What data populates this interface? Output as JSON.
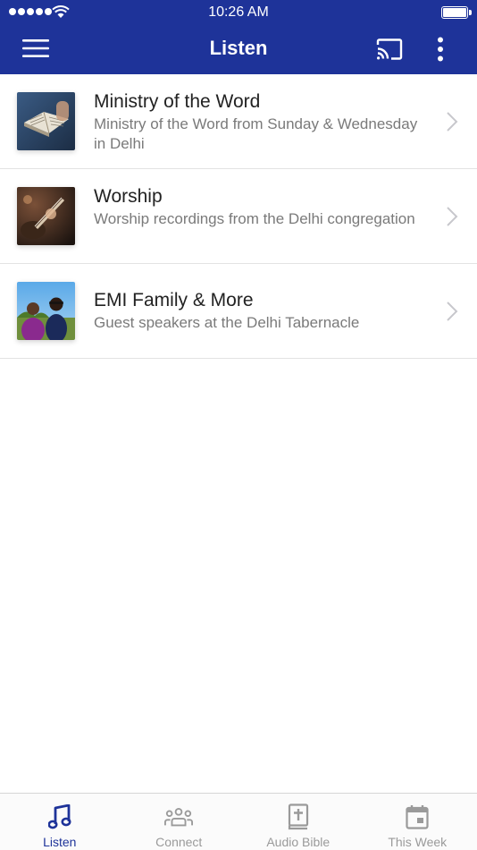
{
  "status_bar": {
    "time": "10:26 AM"
  },
  "nav": {
    "title": "Listen"
  },
  "items": [
    {
      "title": "Ministry of the Word",
      "subtitle": "Ministry of the Word from Sunday & Wednesday in Delhi"
    },
    {
      "title": "Worship",
      "subtitle": "Worship recordings from the Delhi congregation"
    },
    {
      "title": "EMI Family & More",
      "subtitle": "Guest speakers at the Delhi Tabernacle"
    }
  ],
  "tabs": [
    {
      "label": "Listen",
      "icon": "music-note-icon",
      "active": true
    },
    {
      "label": "Connect",
      "icon": "people-icon",
      "active": false
    },
    {
      "label": "Audio Bible",
      "icon": "bible-icon",
      "active": false
    },
    {
      "label": "This Week",
      "icon": "calendar-icon",
      "active": false
    }
  ],
  "colors": {
    "accent": "#1e3399",
    "inactive": "#9a9a9a"
  }
}
